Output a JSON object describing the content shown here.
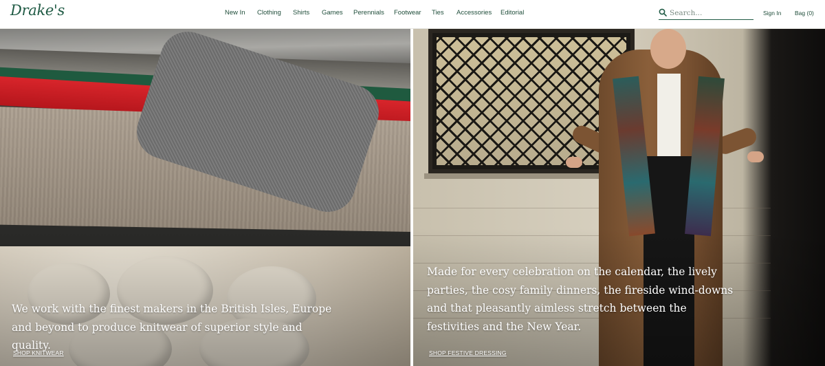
{
  "header": {
    "logo": "Drake's",
    "nav": [
      {
        "label": "New In"
      },
      {
        "label": "Clothing"
      },
      {
        "label": "Shirts"
      },
      {
        "label": "Games"
      },
      {
        "label": "Perennials"
      },
      {
        "label": "Footwear"
      },
      {
        "label": "Ties"
      },
      {
        "label": "Accessories"
      },
      {
        "label": "Editorial"
      }
    ],
    "search": {
      "placeholder": "Search...",
      "value": "",
      "icon": "search-icon"
    },
    "sign_in": "Sign In",
    "bag": "Bag (0)"
  },
  "panels": {
    "knitwear": {
      "text": "We work with the finest makers in the British Isles, Europe and beyond to produce knitwear of superior style and quality.",
      "cta": "SHOP KNITWEAR"
    },
    "festive": {
      "text": "Made for every celebration on the calendar, the lively parties, the cosy family dinners, the fireside wind-downs and that pleasantly aimless stretch between the festivities and the New Year.",
      "cta": "SHOP FESTIVE DRESSING"
    }
  },
  "colors": {
    "brand_green": "#1f5a44",
    "text_white": "#ffffff"
  }
}
